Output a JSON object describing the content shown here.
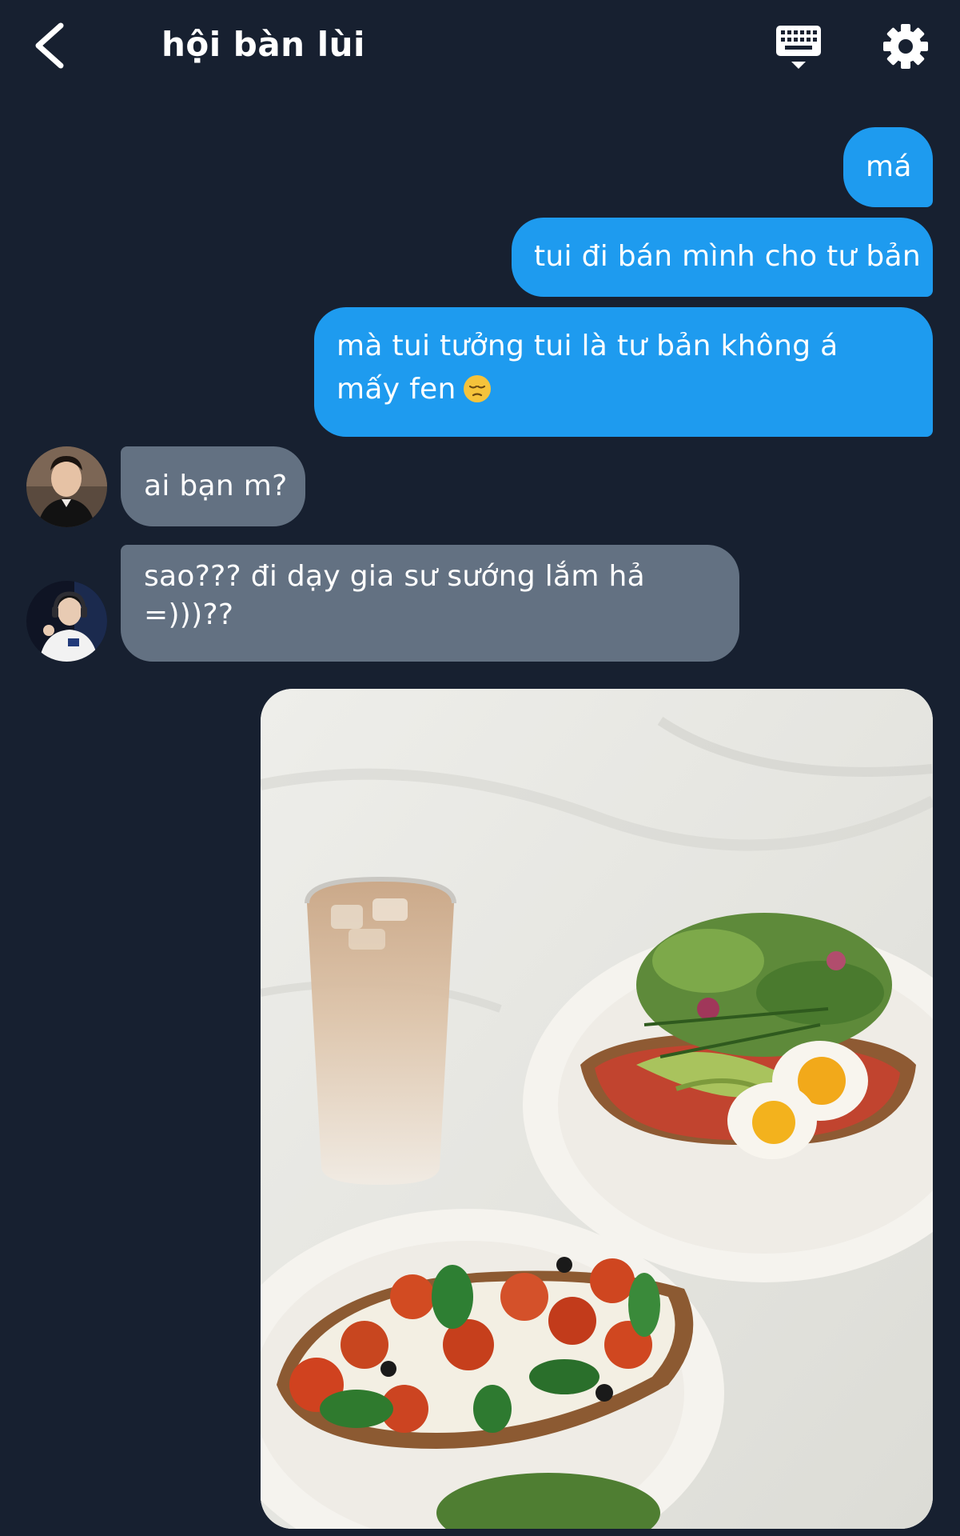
{
  "header": {
    "title": "hội bàn lùi"
  },
  "messages": {
    "m1": "má",
    "m2": "tui đi bán mình cho tư bản",
    "m3": "mà tui tưởng tui là tư bản không á mấy fen",
    "m4": "ai bạn m?",
    "m5": "sao??? đi dạy gia sư sướng lắm hả =)))??"
  },
  "emoji": {
    "m3": "pensive-face"
  },
  "icons": {
    "back": "chevron-left-icon",
    "keyboard": "keyboard-icon",
    "settings": "gear-icon"
  },
  "colors": {
    "background": "#172030",
    "outgoing_bubble": "#1e9bef",
    "incoming_bubble": "#637182"
  }
}
